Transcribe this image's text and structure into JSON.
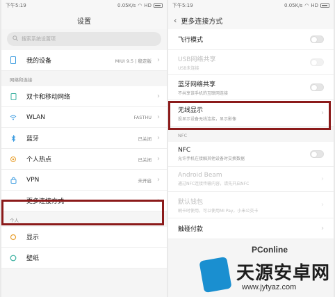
{
  "left": {
    "status": {
      "time": "下午5:19",
      "speed": "0.05K/s",
      "network": "HD"
    },
    "title": "设置",
    "search_placeholder": "搜索系统设置项",
    "device": {
      "label": "我的设备",
      "value": "MIUI 9.5 | 稳定版"
    },
    "section_network": "网络和连接",
    "items": [
      {
        "label": "双卡和移动网络",
        "value": "",
        "icon": "sim-icon"
      },
      {
        "label": "WLAN",
        "value": "FASTHU",
        "icon": "wifi-icon"
      },
      {
        "label": "蓝牙",
        "value": "已关闭",
        "icon": "bluetooth-icon"
      },
      {
        "label": "个人热点",
        "value": "已关闭",
        "icon": "hotspot-icon"
      },
      {
        "label": "VPN",
        "value": "未开启",
        "icon": "vpn-icon"
      },
      {
        "label": "更多连接方式",
        "value": "",
        "icon": "more-icon"
      }
    ],
    "section_personal": "个人",
    "personal_items": [
      {
        "label": "显示",
        "icon": "display-icon"
      },
      {
        "label": "壁纸",
        "icon": "wallpaper-icon"
      }
    ]
  },
  "right": {
    "status": {
      "time": "下午5:19",
      "speed": "0.05K/s",
      "network": "HD"
    },
    "title": "更多连接方式",
    "items": [
      {
        "title": "飞行模式",
        "sub": ""
      },
      {
        "title": "USB网络共享",
        "sub": "USB未连接"
      },
      {
        "title": "蓝牙网络共享",
        "sub": "不共享该手机的互联网连接"
      },
      {
        "title": "无线显示",
        "sub": "投显示设备无线连接，显示影像"
      }
    ],
    "section_nfc": "NFC",
    "nfc_items": [
      {
        "title": "NFC",
        "sub": "允许手机在接触其他设备时交换数据"
      },
      {
        "title": "Android Beam",
        "sub": "通过NFC连接传输内容，请先开启NFC"
      },
      {
        "title": "默认钱包",
        "sub": "刷卡时使用，可以使用MI Pay，小米公交卡"
      },
      {
        "title": "触碰付款",
        "sub": ""
      }
    ]
  },
  "watermark": {
    "brand": "PConline",
    "site_name": "天源安卓网",
    "url": "www.jytyaz.com"
  }
}
